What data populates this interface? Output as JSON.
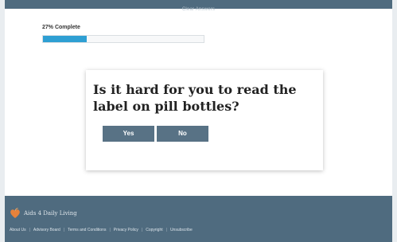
{
  "topbar": {
    "link_label": "Clear Answers"
  },
  "progress": {
    "label": "27% Complete",
    "fraction": 0.27
  },
  "question": {
    "text": "Is it hard for you to read the label on pill bottles?",
    "yes_label": "Yes",
    "no_label": "No"
  },
  "footer": {
    "brand": "Aids 4 Daily Living",
    "links": [
      "About Us",
      "Advisory Board",
      "Terms and Conditions",
      "Privacy Policy",
      "Copyright",
      "Unsubscribe"
    ],
    "separator": "|"
  },
  "colors": {
    "header_footer": "#4f6b7f",
    "progress_fill": "#2e9fd3",
    "answer_button": "#587285",
    "logo": "#e8823a"
  },
  "icons": {
    "brand_logo": "orange-heart-leaf-logo-icon"
  }
}
